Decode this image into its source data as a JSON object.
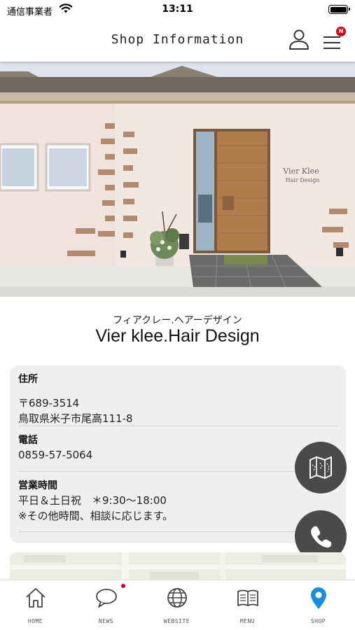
{
  "status_bar": {
    "carrier": "通信事業者",
    "time": "13:11"
  },
  "header": {
    "title": "Shop Information",
    "menu_badge": "N",
    "icons": [
      "user-icon",
      "hamburger-menu-icon"
    ]
  },
  "hero": {
    "sign_text": "Vier Klee Hair Design"
  },
  "shop": {
    "name_kana": "フィアクレー.ヘアーデザイン",
    "name": "Vier klee.Hair Design"
  },
  "info": {
    "address_label": "住所",
    "postal_code": "〒689-3514",
    "address": "鳥取県米子市尾高111-8",
    "phone_label": "電話",
    "phone": "0859-57-5064",
    "hours_label": "営業時間",
    "hours": "平日＆土日祝　＊9:30〜18:00",
    "hours_note": "※その他時間、相談に応じます。"
  },
  "fabs": [
    "map-icon",
    "phone-icon"
  ],
  "tabbar": {
    "tabs": [
      {
        "label": "HOME",
        "icon": "home-icon"
      },
      {
        "label": "NEWS",
        "icon": "chat-bubble-icon"
      },
      {
        "label": "WEBSITE",
        "icon": "globe-icon"
      },
      {
        "label": "MENU",
        "icon": "book-icon"
      },
      {
        "label": "SHOP",
        "icon": "location-pin-icon"
      }
    ],
    "active": "SHOP"
  },
  "colors": {
    "accent": "#1a8fd6",
    "badge": "#d0021b",
    "fab": "#4a4a4a",
    "card": "#efefef"
  }
}
